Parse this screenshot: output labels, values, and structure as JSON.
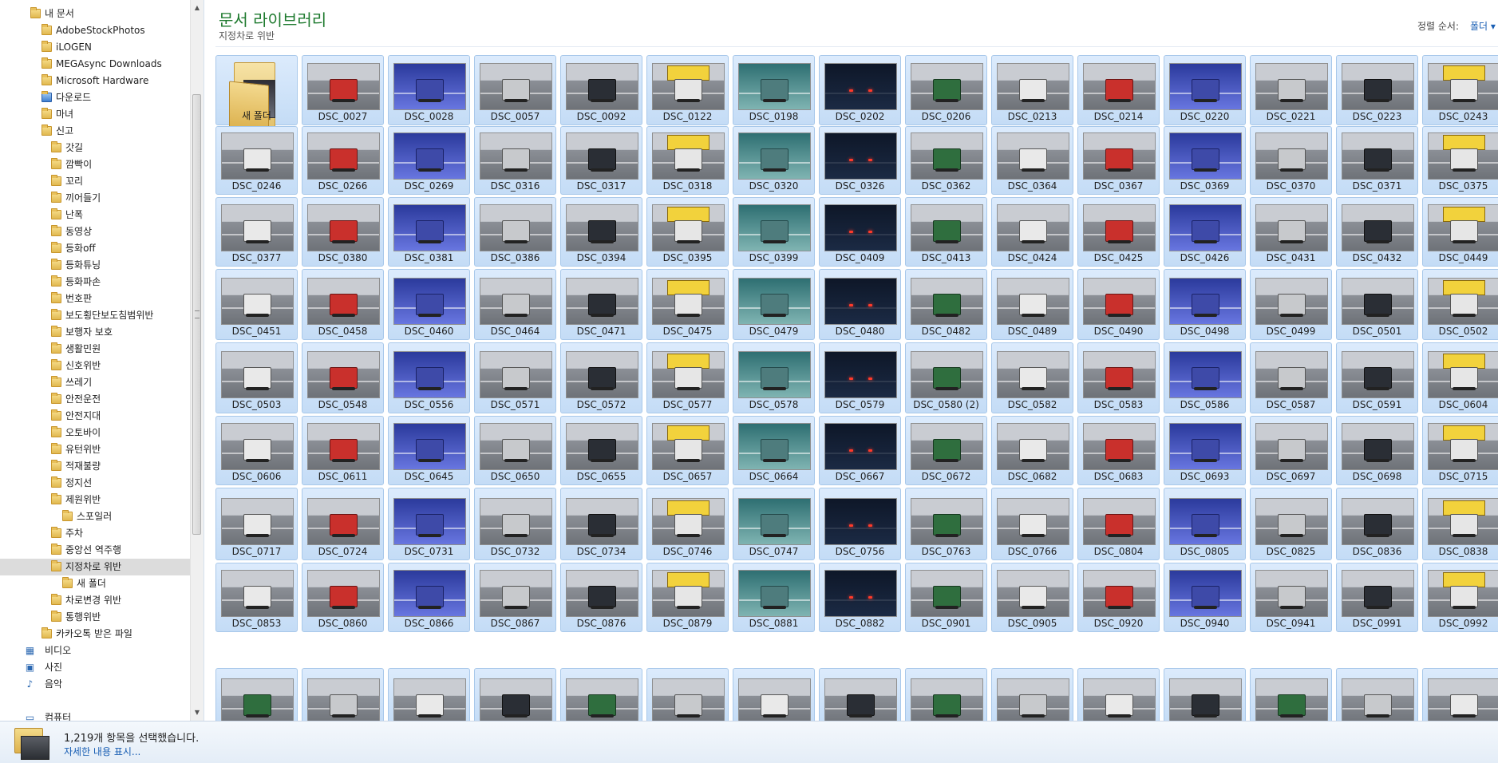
{
  "nav": {
    "items": [
      {
        "label": "내 문서",
        "indent": 0,
        "icon": "folder-icon"
      },
      {
        "label": "AdobeStockPhotos",
        "indent": 1,
        "icon": "folder-icon"
      },
      {
        "label": "iLOGEN",
        "indent": 1,
        "icon": "folder-icon"
      },
      {
        "label": "MEGAsync Downloads",
        "indent": 1,
        "icon": "folder-icon"
      },
      {
        "label": "Microsoft Hardware",
        "indent": 1,
        "icon": "folder-icon"
      },
      {
        "label": "다운로드",
        "indent": 1,
        "icon": "download-folder-icon"
      },
      {
        "label": "마녀",
        "indent": 1,
        "icon": "folder-icon"
      },
      {
        "label": "신고",
        "indent": 1,
        "icon": "folder-icon"
      },
      {
        "label": "갓길",
        "indent": 2,
        "icon": "folder-icon"
      },
      {
        "label": "깜빡이",
        "indent": 2,
        "icon": "folder-icon"
      },
      {
        "label": "꼬리",
        "indent": 2,
        "icon": "folder-icon"
      },
      {
        "label": "끼어들기",
        "indent": 2,
        "icon": "folder-icon"
      },
      {
        "label": "난폭",
        "indent": 2,
        "icon": "folder-icon"
      },
      {
        "label": "동영상",
        "indent": 2,
        "icon": "folder-icon"
      },
      {
        "label": "등화off",
        "indent": 2,
        "icon": "folder-icon"
      },
      {
        "label": "등화튜닝",
        "indent": 2,
        "icon": "folder-icon"
      },
      {
        "label": "등화파손",
        "indent": 2,
        "icon": "folder-icon"
      },
      {
        "label": "번호판",
        "indent": 2,
        "icon": "folder-icon"
      },
      {
        "label": "보도횡단보도침범위반",
        "indent": 2,
        "icon": "folder-icon"
      },
      {
        "label": "보행자 보호",
        "indent": 2,
        "icon": "folder-icon"
      },
      {
        "label": "생활민원",
        "indent": 2,
        "icon": "folder-icon"
      },
      {
        "label": "신호위반",
        "indent": 2,
        "icon": "folder-icon"
      },
      {
        "label": "쓰레기",
        "indent": 2,
        "icon": "folder-icon"
      },
      {
        "label": "안전운전",
        "indent": 2,
        "icon": "folder-icon"
      },
      {
        "label": "안전지대",
        "indent": 2,
        "icon": "folder-icon"
      },
      {
        "label": "오토바이",
        "indent": 2,
        "icon": "folder-icon"
      },
      {
        "label": "유턴위반",
        "indent": 2,
        "icon": "folder-icon"
      },
      {
        "label": "적재불량",
        "indent": 2,
        "icon": "folder-icon"
      },
      {
        "label": "정지선",
        "indent": 2,
        "icon": "folder-icon"
      },
      {
        "label": "제원위반",
        "indent": 2,
        "icon": "folder-icon"
      },
      {
        "label": "스포일러",
        "indent": 3,
        "icon": "folder-icon"
      },
      {
        "label": "주차",
        "indent": 2,
        "icon": "folder-icon"
      },
      {
        "label": "중앙선 역주행",
        "indent": 2,
        "icon": "folder-icon"
      },
      {
        "label": "지정차로 위반",
        "indent": 2,
        "icon": "folder-icon",
        "selected": true
      },
      {
        "label": "새 폴더",
        "indent": 3,
        "icon": "folder-icon"
      },
      {
        "label": "차로변경 위반",
        "indent": 2,
        "icon": "folder-icon"
      },
      {
        "label": "통행위반",
        "indent": 2,
        "icon": "folder-icon"
      },
      {
        "label": "카카오톡 받은 파일",
        "indent": 1,
        "icon": "folder-icon"
      },
      {
        "label": "비디오",
        "indent": 0,
        "icon": "video-library-icon"
      },
      {
        "label": "사진",
        "indent": 0,
        "icon": "pictures-library-icon"
      },
      {
        "label": "음악",
        "indent": 0,
        "icon": "music-library-icon"
      },
      {
        "label": "",
        "indent": 0,
        "icon": "spacer"
      },
      {
        "label": "컴퓨터",
        "indent": 0,
        "icon": "computer-icon"
      }
    ]
  },
  "library": {
    "title": "문서 라이브러리",
    "subtitle": "지정차로 위반",
    "sort_label": "정렬 순서:",
    "sort_value": "폴더 ▾"
  },
  "files": [
    "새 폴더",
    "DSC_0027",
    "DSC_0028",
    "DSC_0057",
    "DSC_0092",
    "DSC_0122",
    "DSC_0198",
    "DSC_0202",
    "DSC_0206",
    "DSC_0213",
    "DSC_0214",
    "DSC_0220",
    "DSC_0221",
    "DSC_0223",
    "DSC_0243",
    "DSC_0246",
    "DSC_0266",
    "DSC_0269",
    "DSC_0316",
    "DSC_0317",
    "DSC_0318",
    "DSC_0320",
    "DSC_0326",
    "DSC_0362",
    "DSC_0364",
    "DSC_0367",
    "DSC_0369",
    "DSC_0370",
    "DSC_0371",
    "DSC_0375",
    "DSC_0377",
    "DSC_0380",
    "DSC_0381",
    "DSC_0386",
    "DSC_0394",
    "DSC_0395",
    "DSC_0399",
    "DSC_0409",
    "DSC_0413",
    "DSC_0424",
    "DSC_0425",
    "DSC_0426",
    "DSC_0431",
    "DSC_0432",
    "DSC_0449",
    "DSC_0451",
    "DSC_0458",
    "DSC_0460",
    "DSC_0464",
    "DSC_0471",
    "DSC_0475",
    "DSC_0479",
    "DSC_0480",
    "DSC_0482",
    "DSC_0489",
    "DSC_0490",
    "DSC_0498",
    "DSC_0499",
    "DSC_0501",
    "DSC_0502",
    "DSC_0503",
    "DSC_0548",
    "DSC_0556",
    "DSC_0571",
    "DSC_0572",
    "DSC_0577",
    "DSC_0578",
    "DSC_0579",
    "DSC_0580 (2)",
    "DSC_0582",
    "DSC_0583",
    "DSC_0586",
    "DSC_0587",
    "DSC_0591",
    "DSC_0604",
    "DSC_0606",
    "DSC_0611",
    "DSC_0645",
    "DSC_0650",
    "DSC_0655",
    "DSC_0657",
    "DSC_0664",
    "DSC_0667",
    "DSC_0672",
    "DSC_0682",
    "DSC_0683",
    "DSC_0693",
    "DSC_0697",
    "DSC_0698",
    "DSC_0715",
    "DSC_0717",
    "DSC_0724",
    "DSC_0731",
    "DSC_0732",
    "DSC_0734",
    "DSC_0746",
    "DSC_0747",
    "DSC_0756",
    "DSC_0763",
    "DSC_0766",
    "DSC_0804",
    "DSC_0805",
    "DSC_0825",
    "DSC_0836",
    "DSC_0838",
    "DSC_0853",
    "DSC_0860",
    "DSC_0866",
    "DSC_0867",
    "DSC_0876",
    "DSC_0879",
    "DSC_0881",
    "DSC_0882",
    "DSC_0901",
    "DSC_0905",
    "DSC_0920",
    "DSC_0940",
    "DSC_0941",
    "DSC_0991",
    "DSC_0992"
  ],
  "status": {
    "count_text": "1,219개 항목을 선택했습니다.",
    "detail_link": "자세한 내용 표시..."
  }
}
